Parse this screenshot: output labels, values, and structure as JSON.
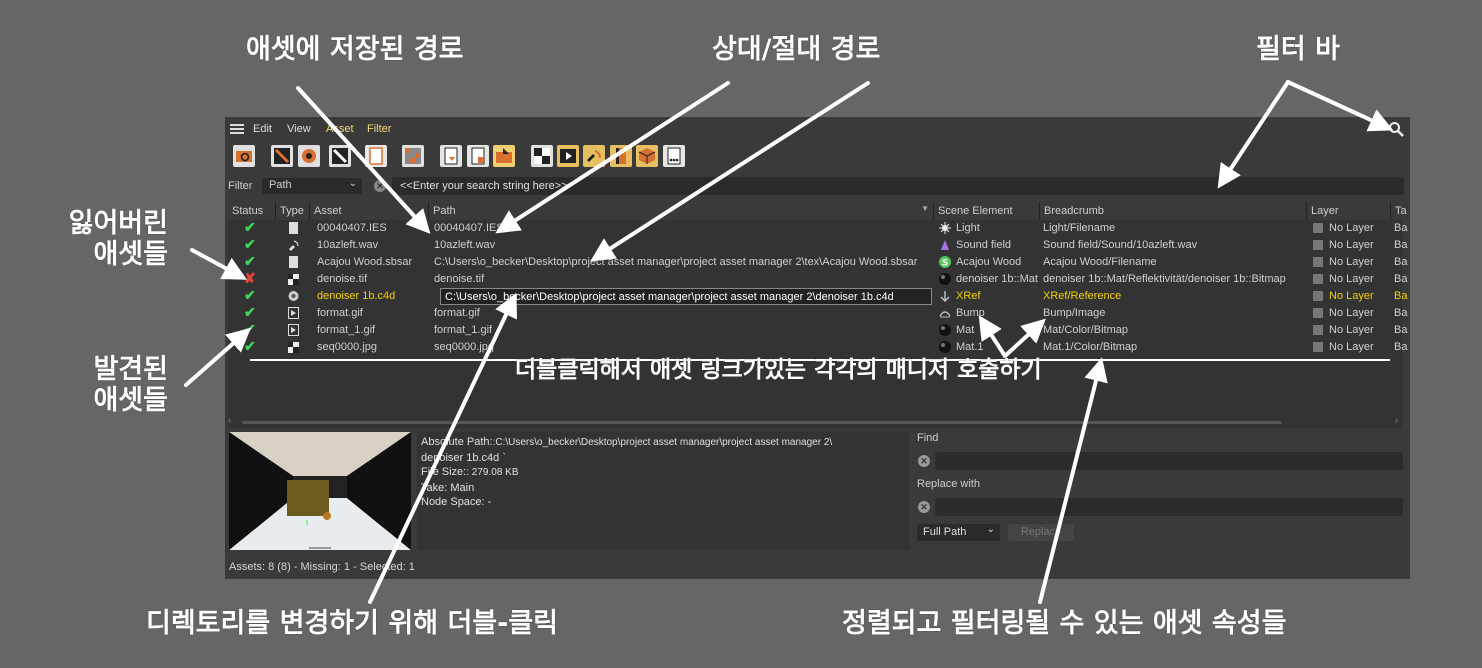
{
  "annotations": {
    "stored_path": "애셋에 저장된 경로",
    "rel_abs_path": "상대/절대 경로",
    "filter_bar": "필터 바",
    "missing_assets": "잃어버린\n애셋들",
    "found_assets": "발견된\n애셋들",
    "double_click_manager": "더블클릭해서 애셋 링크가있는 각각의 매니저 호출하기",
    "double_click_dir": "디렉토리를 변경하기 위해 더블-클릭",
    "sortable_props": "정렬되고 필터링될 수 있는 애셋 속성들"
  },
  "menu": {
    "edit": "Edit",
    "view": "View",
    "asset": "Asset",
    "filter": "Filter"
  },
  "filter": {
    "label": "Filter",
    "mode": "Path",
    "placeholder": "<<Enter your search string here>>"
  },
  "columns": {
    "status": "Status",
    "type": "Type",
    "asset": "Asset",
    "path": "Path",
    "scene_element": "Scene Element",
    "breadcrumb": "Breadcrumb",
    "layer": "Layer",
    "tag": "Ta"
  },
  "rows": [
    {
      "status": "ok",
      "type_icon": "document-icon",
      "asset": "00040407.IES",
      "path": "00040407.IES",
      "scene_icon": "light-icon",
      "scene": "Light",
      "breadcrumb": "Light/Filename",
      "layer": "No Layer",
      "tag": "Ba"
    },
    {
      "status": "ok",
      "type_icon": "sound-icon",
      "asset": "10azleft.wav",
      "path": "10azleft.wav",
      "scene_icon": "sound-field-icon",
      "scene": "Sound field",
      "breadcrumb": "Sound field/Sound/10azleft.wav",
      "layer": "No Layer",
      "tag": "Ba"
    },
    {
      "status": "ok",
      "type_icon": "document-icon",
      "asset": "Acajou Wood.sbsar",
      "path": "C:\\Users\\o_becker\\Desktop\\project asset manager\\project asset manager 2\\tex\\Acajou Wood.sbsar",
      "scene_icon": "substance-icon",
      "scene": "Acajou Wood",
      "breadcrumb": "Acajou Wood/Filename",
      "layer": "No Layer",
      "tag": "Ba"
    },
    {
      "status": "missing",
      "type_icon": "checker-icon",
      "asset": "denoise.tif",
      "path": "denoise.tif",
      "scene_icon": "material-icon",
      "scene": "denoiser 1b::Mat",
      "breadcrumb": "denoiser 1b::Mat/Reflektivität/denoiser 1b::Bitmap",
      "layer": "No Layer",
      "tag": "Ba"
    },
    {
      "status": "ok",
      "type_icon": "xref-icon",
      "asset": "denoiser 1b.c4d",
      "path": "C:\\Users\\o_becker\\Desktop\\project asset manager\\project asset manager 2\\denoiser 1b.c4d",
      "scene_icon": "xref-icon",
      "scene": "XRef",
      "breadcrumb": "XRef/Reference",
      "layer": "No Layer",
      "tag": "Ba",
      "highlight": true
    },
    {
      "status": "ok",
      "type_icon": "image-icon",
      "asset": "format.gif",
      "path": "format.gif",
      "scene_icon": "bump-icon",
      "scene": "Bump",
      "breadcrumb": "Bump/Image",
      "layer": "No Layer",
      "tag": "Ba"
    },
    {
      "status": "ok",
      "type_icon": "image-icon",
      "asset": "format_1.gif",
      "path": "format_1.gif",
      "scene_icon": "material-icon",
      "scene": "Mat",
      "breadcrumb": "Mat/Color/Bitmap",
      "layer": "No Layer",
      "tag": "Ba"
    },
    {
      "status": "ok",
      "type_icon": "checker-icon",
      "asset": "seq0000.jpg",
      "path": "seq0000.jpg",
      "scene_icon": "material-icon",
      "scene": "Mat.1",
      "breadcrumb": "Mat.1/Color/Bitmap",
      "layer": "No Layer",
      "tag": "Ba"
    }
  ],
  "info": {
    "abs_path_label": "Absolute Path:",
    "abs_path_value": ":C:\\Users\\o_becker\\Desktop\\project asset manager\\project asset manager 2\\",
    "abs_path_value2": "denoiser 1b.c4d `",
    "file_size_label": "File Size:",
    "file_size_value": ": 279.08 KB",
    "take_label": "Take:",
    "take_value": "Main",
    "node_space_label": "Node Space:",
    "node_space_value": "-"
  },
  "find_replace": {
    "find_label": "Find",
    "replace_label": "Replace with",
    "scope": "Full Path",
    "replace_button": "Replace"
  },
  "status_bar": "Assets: 8 (8) - Missing: 1 - Selected: 1",
  "colors": {
    "ok": "#3fd45a",
    "missing": "#e8443a",
    "highlight": "#f0d000",
    "menu_accent": "#f2d97a"
  }
}
